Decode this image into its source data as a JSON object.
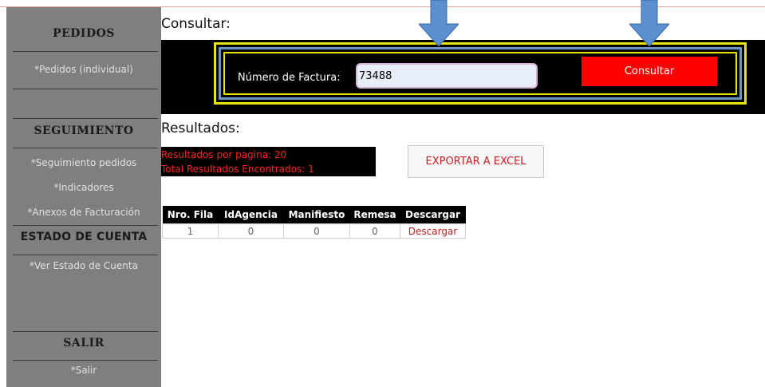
{
  "sidebar": {
    "pedidos_title": "PEDIDOS",
    "pedidos_individual": "*Pedidos (individual)",
    "seguimiento_title": "SEGUIMIENTO",
    "seguimiento_pedidos": "*Seguimiento pedidos",
    "indicadores": "*Indicadores",
    "anexos": "*Anexos de Facturación",
    "estado_title": "ESTADO DE CUENTA",
    "ver_estado": "*Ver Estado de Cuenta",
    "salir_title": "SALIR",
    "salir": "*Salir"
  },
  "consultar": {
    "heading": "Consultar:",
    "field_label": "Número de Factura:",
    "field_value": "73488",
    "button_label": "Consultar"
  },
  "resultados": {
    "heading": "Resultados:",
    "per_page": "Resultados por pagina: 20",
    "total": "Total Resultados Encontrados: 1",
    "export_label": "EXPORTAR A EXCEL",
    "columns": [
      "Nro. Fila",
      "IdAgencia",
      "Manifiesto",
      "Remesa",
      "Descargar"
    ],
    "rows": [
      [
        "1",
        "0",
        "0",
        "0",
        "Descargar"
      ]
    ]
  },
  "colors": {
    "sidebar": "#7f7f7f",
    "accent_red": "#ff0000",
    "annotation_arrow": "#5b8fd0",
    "highlight_yellow": "#e5e500"
  }
}
